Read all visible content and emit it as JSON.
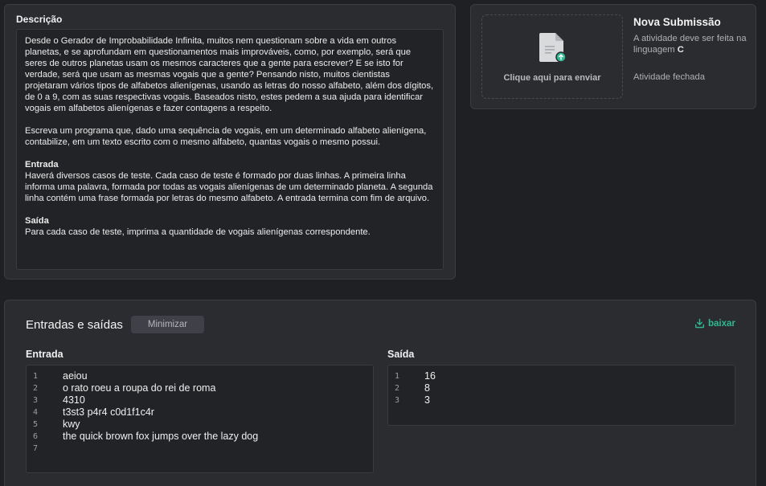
{
  "description": {
    "title": "Descrição",
    "paragraph1": "Desde o Gerador de Improbabilidade Infinita, muitos nem questionam sobre a vida em outros planetas, e se aprofundam em questionamentos mais improváveis, como, por exemplo, será que seres de outros planetas usam os mesmos caracteres que a gente para escrever? E se isto for verdade, será que usam as mesmas vogais que a gente? Pensando nisto, muitos cientistas projetaram vários tipos de alfabetos alienígenas, usando as letras do nosso alfabeto, além dos dígitos, de 0 a 9, com as suas respectivas vogais. Baseados nisto, estes pedem a sua ajuda para identificar vogais em alfabetos alienígenas e fazer contagens a respeito.",
    "paragraph2": "Escreva um programa que, dado uma sequência de vogais, em um determinado alfabeto alienígena, contabilize, em um texto escrito com o mesmo alfabeto, quantas vogais o mesmo possui.",
    "input_title": "Entrada",
    "input_text": "Haverá diversos casos de teste. Cada caso de teste é formado por duas linhas. A primeira linha informa uma palavra, formada por todas as vogais alienígenas de um determinado planeta. A segunda linha contém uma frase formada por letras do mesmo alfabeto. A entrada termina com fim de arquivo.",
    "output_title": "Saída",
    "output_text": "Para cada caso de teste, imprima a quantidade de vogais alienígenas correspondente."
  },
  "submission": {
    "title": "Nova Submissão",
    "upload_label": "Clique aqui para enviar",
    "info_prefix": "A atividade deve ser feita na linguagem",
    "language": "C",
    "status": "Atividade fechada",
    "upload_icon": "file-upload-icon"
  },
  "io": {
    "title": "Entradas e saídas",
    "minimize_label": "Minimizar",
    "download_label": "baixar",
    "download_icon": "download-icon",
    "accent_color": "#2fb892",
    "input_label": "Entrada",
    "output_label": "Saída",
    "input_lines": [
      {
        "num": "1",
        "text": "aeiou"
      },
      {
        "num": "2",
        "text": "o rato roeu a roupa do rei de roma"
      },
      {
        "num": "3",
        "text": "4310"
      },
      {
        "num": "4",
        "text": "t3st3 p4r4 c0d1f1c4r"
      },
      {
        "num": "5",
        "text": "kwy"
      },
      {
        "num": "6",
        "text": "the quick brown fox jumps over the lazy dog"
      },
      {
        "num": "7",
        "text": ""
      }
    ],
    "output_lines": [
      {
        "num": "1",
        "text": "16"
      },
      {
        "num": "2",
        "text": "8"
      },
      {
        "num": "3",
        "text": "3"
      }
    ]
  }
}
